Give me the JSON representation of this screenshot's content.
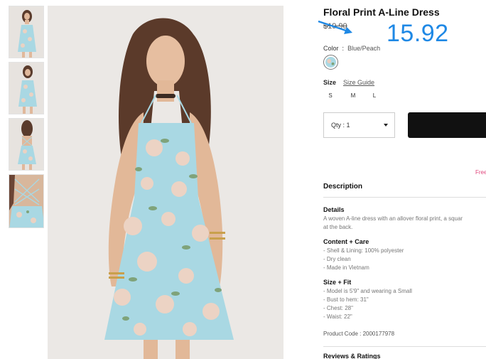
{
  "product": {
    "title": "Floral Print A-Line Dress",
    "old_price": "$19.90",
    "new_price": "15.92"
  },
  "color": {
    "label": "Color",
    "separator": ":",
    "value": "Blue/Peach"
  },
  "size": {
    "label": "Size",
    "guide_link": "Size Guide",
    "options": [
      "S",
      "M",
      "L"
    ]
  },
  "quantity": {
    "label": "Qty : 1"
  },
  "free_shipping_fragment": "Free",
  "description": {
    "heading": "Description",
    "details_heading": "Details",
    "details_lines": [
      "A woven A-line dress with an allover floral print, a squar",
      "at the back."
    ],
    "content_heading": "Content + Care",
    "content_lines": [
      "- Shell & Lining: 100% polyester",
      "- Dry clean",
      "- Made in Vietnam"
    ],
    "fit_heading": "Size + Fit",
    "fit_lines": [
      "- Model is 5'9\" and wearing a Small",
      "- Bust to hem: 31\"",
      "- Chest: 28\"",
      "- Waist: 22\""
    ],
    "product_code": "Product Code : 2000177978"
  },
  "reviews_heading": "Reviews & Ratings",
  "colors": {
    "accent_price": "#1e88e5",
    "button": "#111111",
    "free_shipping": "#e0467c",
    "dress": "#a9d8e3"
  }
}
